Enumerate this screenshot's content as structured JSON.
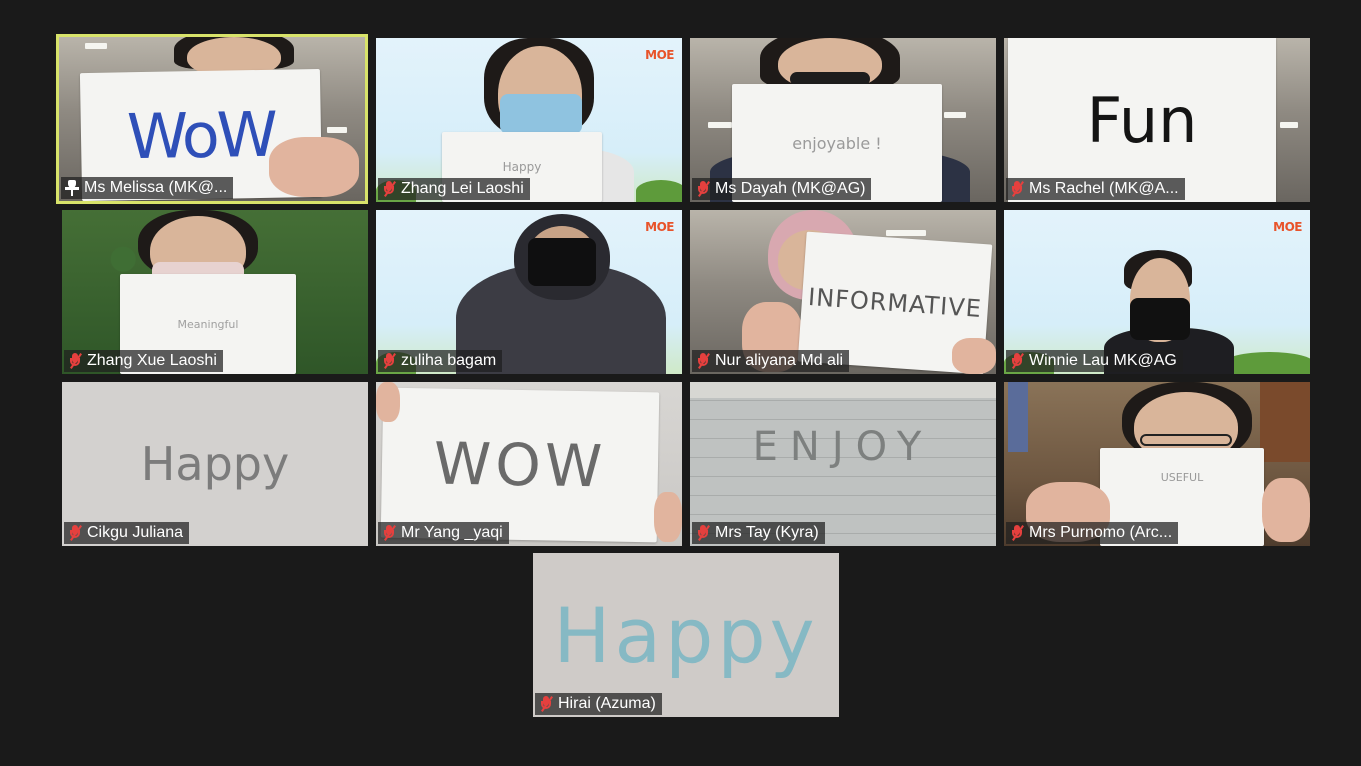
{
  "participants": [
    {
      "name": "Ms Melissa (MK@...",
      "sign": "WoW",
      "active": true,
      "pinned": true
    },
    {
      "name": "Zhang Lei Laoshi",
      "sign": "Happy",
      "logo": "MOE"
    },
    {
      "name": "Ms Dayah (MK@AG)",
      "sign": "enjoyable !"
    },
    {
      "name": "Ms Rachel (MK@A...",
      "sign": "Fun"
    },
    {
      "name": "Zhang Xue Laoshi",
      "sign": "Meaningful"
    },
    {
      "name": "zuliha bagam",
      "logo": "MOE"
    },
    {
      "name": "Nur aliyana Md ali",
      "sign": "INFORMATIVE"
    },
    {
      "name": "Winnie Lau MK@AG",
      "logo": "MOE"
    },
    {
      "name": "Cikgu Juliana",
      "sign": "Happy"
    },
    {
      "name": "Mr Yang _yaqi",
      "sign": "WOW"
    },
    {
      "name": "Mrs Tay (Kyra)",
      "sign": "ENJOY"
    },
    {
      "name": "Mrs Purnomo (Arc...",
      "sign": "USEFUL"
    },
    {
      "name": "Hirai (Azuma)",
      "sign": "Happy"
    }
  ],
  "colors": {
    "background": "#1a1a1a",
    "active_speaker_border": "#d8e36a",
    "muted_icon": "#e5403e"
  },
  "icons": {
    "muted": "mic-muted-icon",
    "pinned": "pin-icon"
  }
}
